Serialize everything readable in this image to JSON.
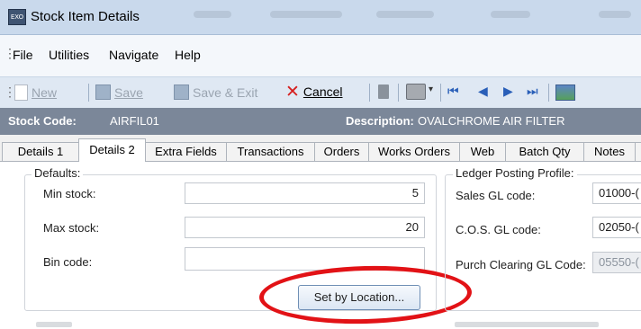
{
  "window": {
    "title": "Stock Item Details",
    "app_icon_text": "EXO"
  },
  "menu": {
    "items": [
      "File",
      "Utilities",
      "Navigate",
      "Help"
    ]
  },
  "toolbar": {
    "new_label": "New",
    "save_label": "Save",
    "save_exit_label": "Save & Exit",
    "cancel_label": "Cancel"
  },
  "header": {
    "stock_code_label": "Stock Code:",
    "stock_code_value": "AIRFIL01",
    "description_label": "Description:",
    "description_value": "OVALCHROME AIR FILTER"
  },
  "tabs": [
    {
      "label": "Details 1"
    },
    {
      "label": "Details 2",
      "selected": true
    },
    {
      "label": "Extra Fields"
    },
    {
      "label": "Transactions"
    },
    {
      "label": "Orders"
    },
    {
      "label": "Works Orders"
    },
    {
      "label": "Web"
    },
    {
      "label": "Batch Qty"
    },
    {
      "label": "Notes"
    }
  ],
  "defaults": {
    "title": "Defaults:",
    "min_stock_label": "Min stock:",
    "min_stock_value": "5",
    "max_stock_label": "Max stock:",
    "max_stock_value": "20",
    "bin_code_label": "Bin code:",
    "bin_code_value": "",
    "set_by_location_label": "Set by Location..."
  },
  "ledger": {
    "title": "Ledger Posting Profile:",
    "sales_gl_label": "Sales GL code:",
    "sales_gl_value": "01000-(",
    "cos_gl_label": "C.O.S. GL code:",
    "cos_gl_value": "02050-(",
    "purch_clearing_label": "Purch Clearing GL Code:",
    "purch_clearing_value": "05550-("
  },
  "colors": {
    "highlight": "#e21216",
    "header_bg": "#7b8799",
    "accent_blue": "#2a5fb8"
  }
}
